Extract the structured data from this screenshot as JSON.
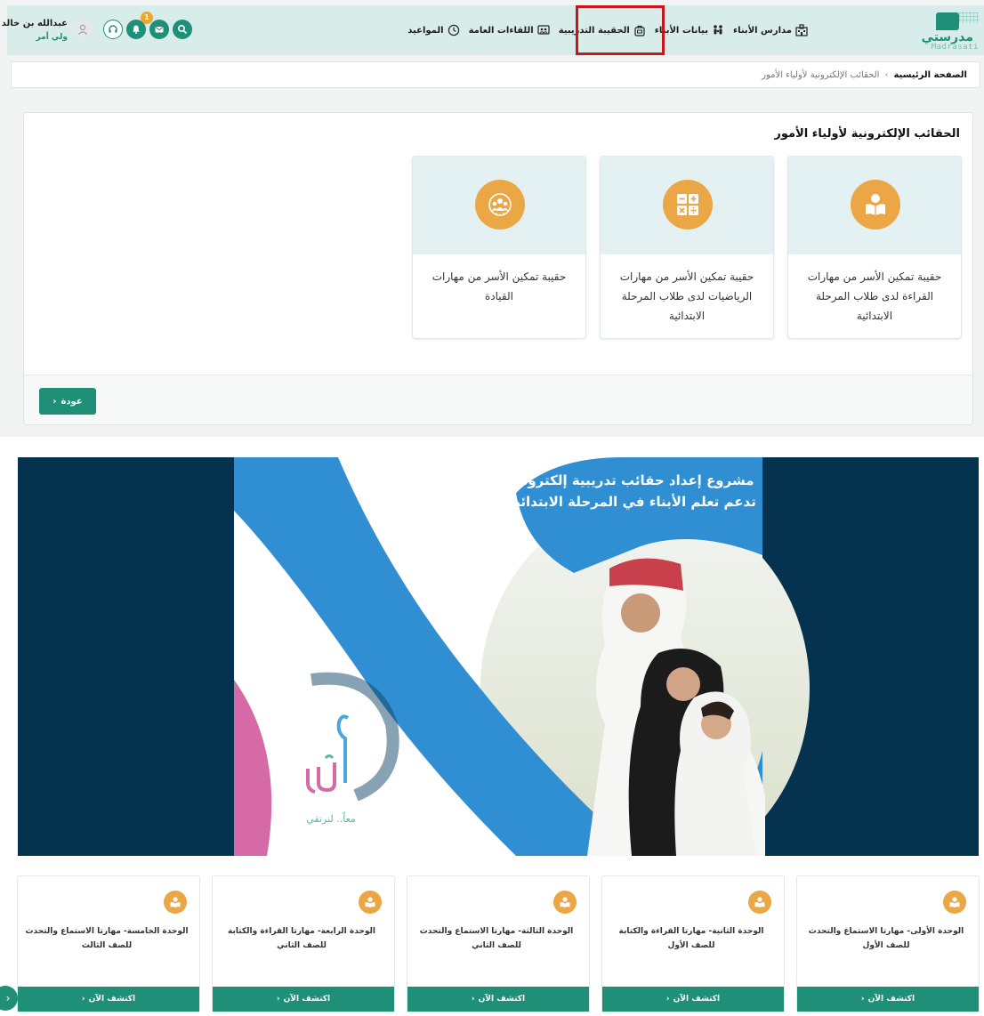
{
  "brand": {
    "name": "مدرستي",
    "latin": "Madrasati"
  },
  "nav": {
    "items": [
      {
        "label": "مدارس الأبناء",
        "icon": "school-icon"
      },
      {
        "label": "بيانات الأبناء",
        "icon": "children-icon"
      },
      {
        "label": "الحقيبة التدريبية",
        "icon": "bag-icon",
        "active": true
      },
      {
        "label": "اللقاءات العامة",
        "icon": "meetings-icon"
      },
      {
        "label": "المواعيد",
        "icon": "clock-icon"
      }
    ]
  },
  "header": {
    "notification_count": "1",
    "user_name": "عبدالله بن خالد",
    "user_role": "ولي أمر"
  },
  "breadcrumb": {
    "home": "الصفحة الرئيسية",
    "separator": "›",
    "current": "الحقائب الإلكترونية لأولياء الأمور"
  },
  "main": {
    "title": "الحقائب الإلكترونية لأولياء الأمور",
    "kits": [
      {
        "label": "حقيبة تمكين الأسر من مهارات القراءة لدى طلاب المرحلة الابتدائية",
        "icon": "reading-icon"
      },
      {
        "label": "حقيبة تمكين الأسر من مهارات الرياضيات لدى طلاب المرحلة الابتدائية",
        "icon": "math-icon"
      },
      {
        "label": "حقيبة تمكين الأسر من مهارات القيادة",
        "icon": "leadership-icon"
      }
    ],
    "back_label": "عودة"
  },
  "banner": {
    "line1": "مشروع إعداد حقائب تدريبية إلكترونية",
    "line2": "تدعم تعلم الأبناء في المرحلة الابتدائية",
    "logo_tagline": "معاً.. لنرتقي"
  },
  "units": [
    {
      "title": "الوحدة الأولى- مهارتا الاستماع والتحدث للصف الأول",
      "button": "اكتشف الآن"
    },
    {
      "title": "الوحدة الثانية- مهارتا القراءة والكتابة للصف الأول",
      "button": "اكتشف الآن"
    },
    {
      "title": "الوحدة الثالثة- مهارتا الاستماع والتحدث للصف الثاني",
      "button": "اكتشف الآن"
    },
    {
      "title": "الوحدة الرابعة- مهارتا القراءة والكتابة للصف الثاني",
      "button": "اكتشف الآن"
    },
    {
      "title": "الوحدة الخامسة- مهارتا الاستماع والتحدث للصف الثالث",
      "button": "اكتشف الآن"
    }
  ],
  "colors": {
    "primary": "#1f8f78",
    "accent": "#eba646",
    "nav_bg": "#d8ede9",
    "highlight": "#c8161d",
    "banner_bg": "#04324f"
  }
}
